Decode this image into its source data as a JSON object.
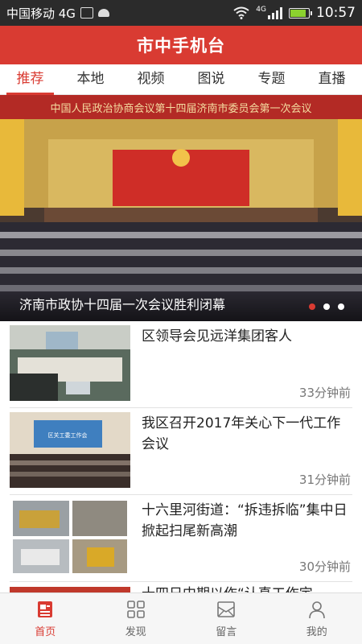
{
  "status_bar": {
    "carrier": "中国移动 4G",
    "network": "4G",
    "battery_level": 0.85,
    "time": "10:57",
    "icons": [
      "image-icon",
      "android-icon",
      "wifi-icon",
      "signal-icon",
      "battery-icon"
    ]
  },
  "app": {
    "title": "市中手机台"
  },
  "tabs": [
    {
      "label": "推荐",
      "active": true
    },
    {
      "label": "本地"
    },
    {
      "label": "视频"
    },
    {
      "label": "图说"
    },
    {
      "label": "专题"
    },
    {
      "label": "直播"
    }
  ],
  "hero": {
    "banner_text": "中国人民政治协商会议第十四届济南市委员会第一次会议",
    "caption": "济南市政协十四届一次会议胜利闭幕",
    "slide_count": 3,
    "active_slide": 1
  },
  "news": [
    {
      "title": "区领导会见远洋集团客人",
      "time": "33分钟前",
      "thumb_text": ""
    },
    {
      "title": "我区召开2017年关心下一代工作会议",
      "time": "31分钟前",
      "thumb_text": "区关工委工作会"
    },
    {
      "title": "十六里河街道：“拆违拆临”集中日 掀起扫尾新高潮",
      "time": "30分钟前",
      "thumb_text": ""
    },
    {
      "title": "十四日中期以作“认真工作定",
      "time": "",
      "thumb_text": ""
    }
  ],
  "bottom_nav": [
    {
      "label": "首页",
      "icon": "home-news-icon",
      "active": true
    },
    {
      "label": "发现",
      "icon": "grid-icon"
    },
    {
      "label": "留言",
      "icon": "message-icon"
    },
    {
      "label": "我的",
      "icon": "user-icon"
    }
  ],
  "colors": {
    "accent": "#d93b32",
    "status_bar": "#2b2b2b"
  }
}
